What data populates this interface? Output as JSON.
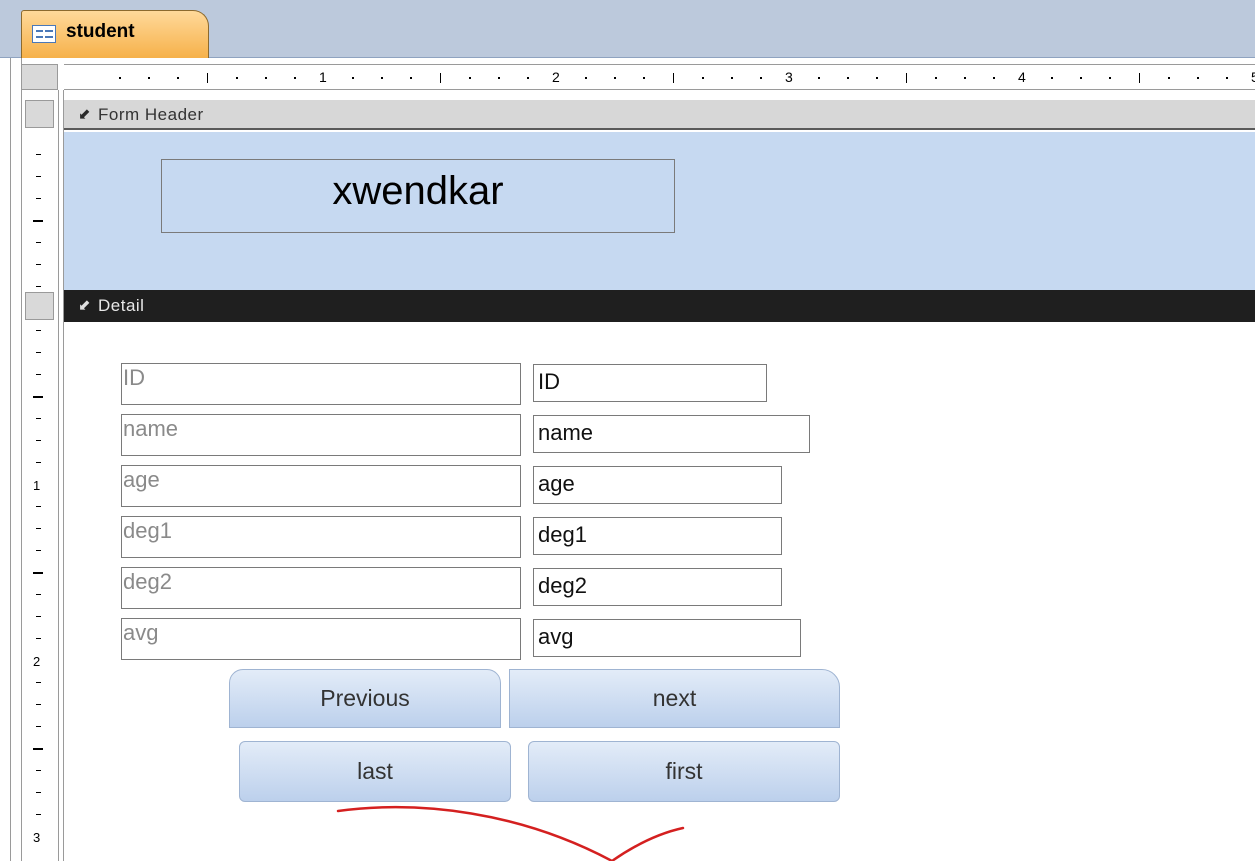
{
  "tab": {
    "title": "student"
  },
  "ruler": {
    "numbers": [
      "1",
      "2",
      "3",
      "4",
      "5"
    ],
    "vertical_numbers": [
      "1",
      "2",
      "3"
    ]
  },
  "sections": {
    "header": "Form Header",
    "detail": "Detail"
  },
  "header": {
    "title": "xwendkar"
  },
  "detail": {
    "fields": [
      {
        "label": "ID",
        "control": "ID"
      },
      {
        "label": "name",
        "control": "name"
      },
      {
        "label": "age",
        "control": "age"
      },
      {
        "label": "deg1",
        "control": "deg1"
      },
      {
        "label": "deg2",
        "control": "deg2"
      },
      {
        "label": "avg",
        "control": "avg"
      }
    ],
    "buttons": {
      "previous": "Previous",
      "next": "next",
      "last": "last",
      "first": "first"
    }
  },
  "colors": {
    "header_background": "#c6d9f1",
    "detail_bar": "#1f1f1f",
    "tab_active": "#f6b14a",
    "annotation": "#d42020"
  },
  "icons": {
    "tab": "form-icon",
    "section": "section-arrow-icon"
  }
}
